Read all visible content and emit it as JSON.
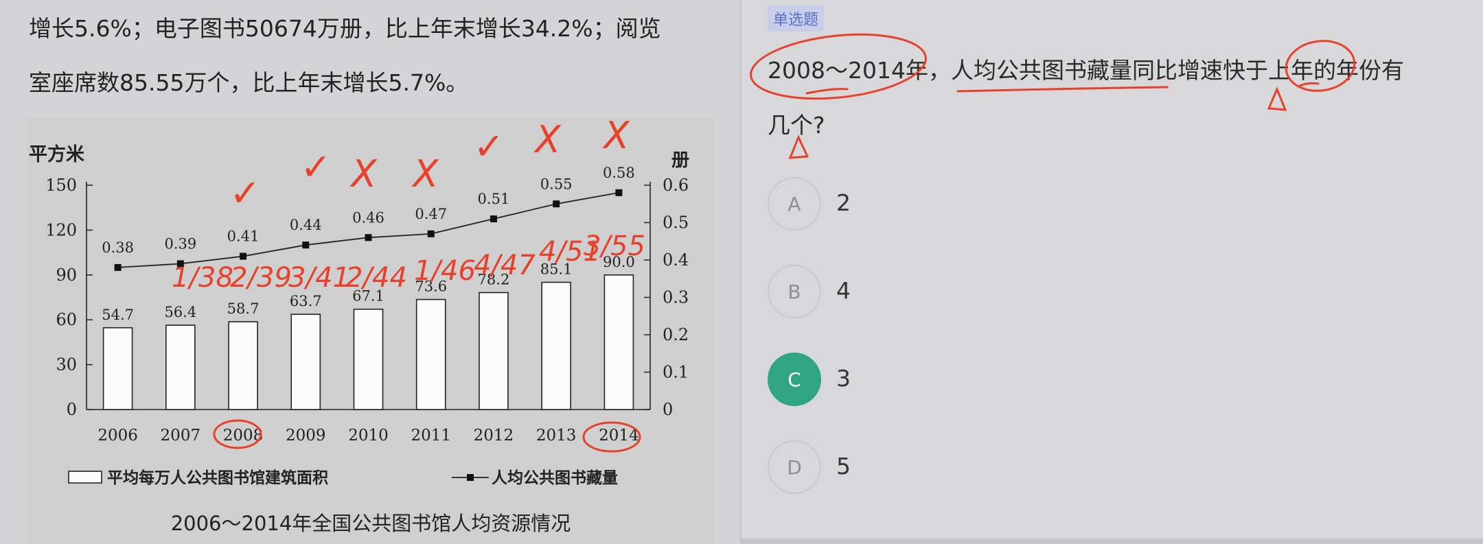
{
  "passage": {
    "line1": "增长5.6%；电子图书50674万册，比上年末增长34.2%；阅览",
    "line2": "室座席数85.55万个，比上年末增长5.7%。"
  },
  "chart_data": {
    "type": "bar",
    "title": "2006～2014年全国公共图书馆人均资源情况",
    "categories": [
      "2006",
      "2007",
      "2008",
      "2009",
      "2010",
      "2011",
      "2012",
      "2013",
      "2014"
    ],
    "series": [
      {
        "name": "平均每万人公共图书馆建筑面积",
        "type": "bar",
        "axis": "left",
        "values": [
          54.7,
          56.4,
          58.7,
          63.7,
          67.1,
          73.6,
          78.2,
          85.1,
          90.0
        ],
        "labels": [
          "54.7",
          "56.4",
          "58.7",
          "63.7",
          "67.1",
          "73.6",
          "78.2",
          "85.1",
          "90.0"
        ]
      },
      {
        "name": "人均公共图书藏量",
        "type": "line",
        "axis": "right",
        "values": [
          0.38,
          0.39,
          0.41,
          0.44,
          0.46,
          0.47,
          0.51,
          0.55,
          0.58
        ],
        "labels": [
          "0.38",
          "0.39",
          "0.41",
          "0.44",
          "0.46",
          "0.47",
          "0.51",
          "0.55",
          "0.58"
        ]
      }
    ],
    "ylabel": "平方米",
    "y2label": "册",
    "ylim": [
      0,
      150
    ],
    "y2lim": [
      0,
      0.6
    ],
    "yticks": [
      "0",
      "30",
      "60",
      "90",
      "120",
      "150"
    ],
    "y2ticks": [
      "0",
      "0.1",
      "0.2",
      "0.3",
      "0.4",
      "0.5",
      "0.6"
    ],
    "legend_position": "bottom",
    "grid": false
  },
  "question": {
    "tag": "单选题",
    "line1": "2008～2014年，人均公共图书藏量同比增速快于上年的年份有",
    "line2": "几个?"
  },
  "options": [
    {
      "letter": "A",
      "text": "2",
      "selected": false
    },
    {
      "letter": "B",
      "text": "4",
      "selected": false
    },
    {
      "letter": "C",
      "text": "3",
      "selected": true
    },
    {
      "letter": "D",
      "text": "5",
      "selected": false
    }
  ],
  "annotations": {
    "marks": [
      "✓",
      "✓",
      "X",
      "X",
      "✓",
      "X",
      "X"
    ],
    "fractions": [
      "1/38",
      "2/39",
      "3/41",
      "2/44",
      "1/46",
      "4/47",
      "4/51",
      "3/55"
    ],
    "ink_color": "#e8412b"
  },
  "colors": {
    "accent": "#2fa584",
    "tag_bg": "#c8cde9",
    "tag_text": "#5a6fd0"
  }
}
